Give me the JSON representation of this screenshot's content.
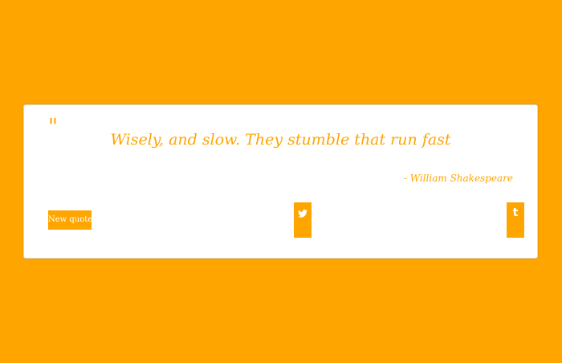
{
  "colors": {
    "background": "#FFA500",
    "card": "#FFFFFF",
    "accent": "#FFA500",
    "button_text": "#FFFFFF"
  },
  "quote": {
    "mark": "\"",
    "text": "Wisely, and slow. They stumble that run fast",
    "author": "- William Shakespeare"
  },
  "actions": {
    "new_quote_label": "New quote",
    "twitter_icon": "twitter-icon",
    "tumblr_icon": "tumblr-icon",
    "tumblr_glyph": "t"
  }
}
